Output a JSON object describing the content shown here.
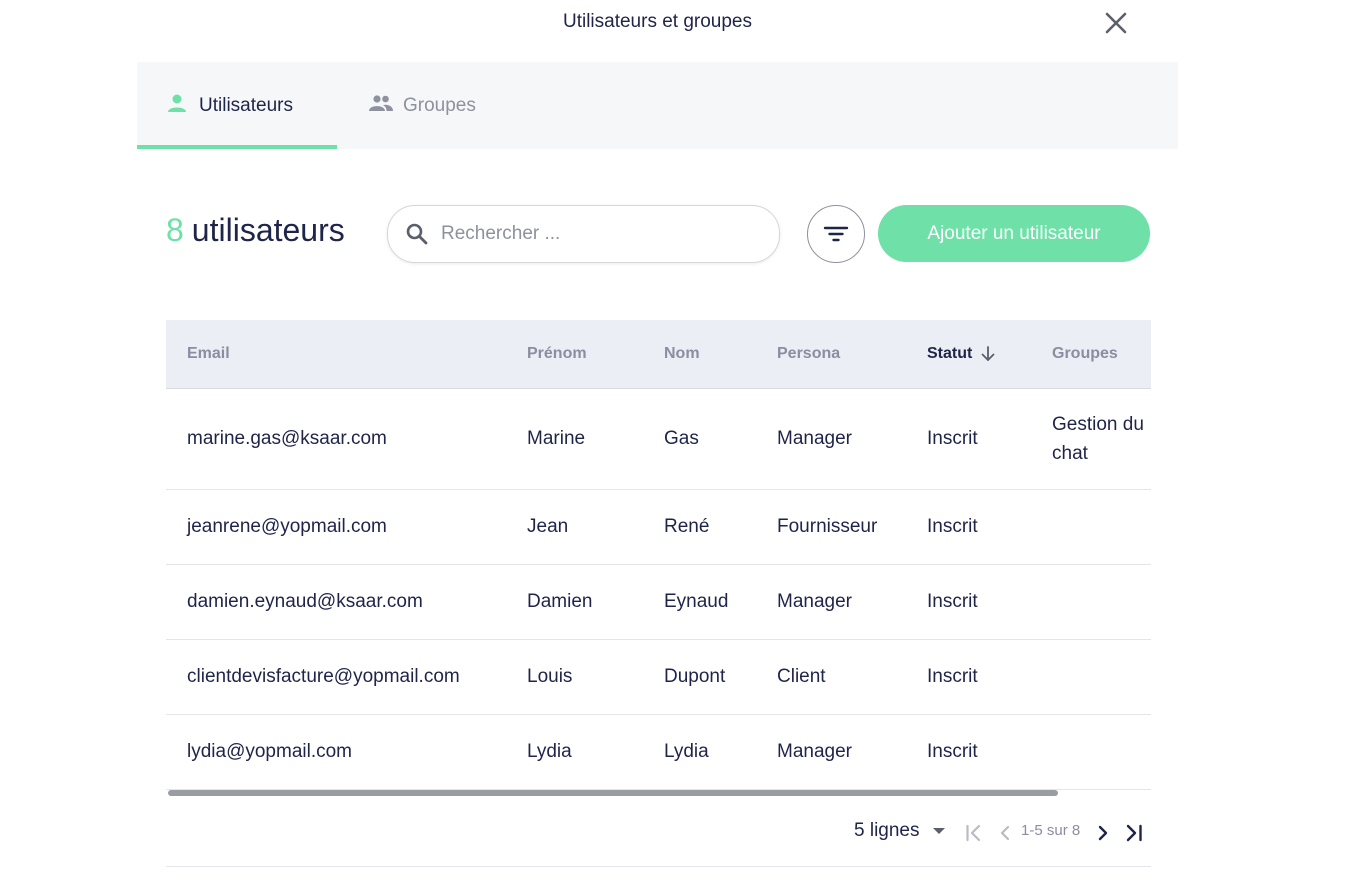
{
  "modal": {
    "title": "Utilisateurs et groupes"
  },
  "tabs": [
    {
      "label": "Utilisateurs",
      "icon": "person-icon",
      "active": true
    },
    {
      "label": "Groupes",
      "icon": "group-icon",
      "active": false
    }
  ],
  "heading": {
    "count": "8",
    "label": "utilisateurs"
  },
  "search": {
    "placeholder": "Rechercher ...",
    "value": ""
  },
  "actions": {
    "add_user_label": "Ajouter un utilisateur"
  },
  "table": {
    "columns": [
      "Email",
      "Prénom",
      "Nom",
      "Persona",
      "Statut",
      "Groupes"
    ],
    "sorted_column": "Statut",
    "rows": [
      {
        "email": "marine.gas@ksaar.com",
        "first": "Marine",
        "last": "Gas",
        "persona": "Manager",
        "status": "Inscrit",
        "groups": "Gestion du chat"
      },
      {
        "email": "jeanrene@yopmail.com",
        "first": "Jean",
        "last": "René",
        "persona": "Fournisseur",
        "status": "Inscrit",
        "groups": ""
      },
      {
        "email": "damien.eynaud@ksaar.com",
        "first": "Damien",
        "last": "Eynaud",
        "persona": "Manager",
        "status": "Inscrit",
        "groups": ""
      },
      {
        "email": "clientdevisfacture@yopmail.com",
        "first": "Louis",
        "last": "Dupont",
        "persona": "Client",
        "status": "Inscrit",
        "groups": ""
      },
      {
        "email": "lydia@yopmail.com",
        "first": "Lydia",
        "last": "Lydia",
        "persona": "Manager",
        "status": "Inscrit",
        "groups": ""
      }
    ]
  },
  "pagination": {
    "rows_per_page": "5 lignes",
    "range": "1-5 sur 8"
  },
  "colors": {
    "accent": "#6ee0a8",
    "text": "#1f2449",
    "muted": "#8e919e",
    "header_bg": "#ebeef5"
  }
}
